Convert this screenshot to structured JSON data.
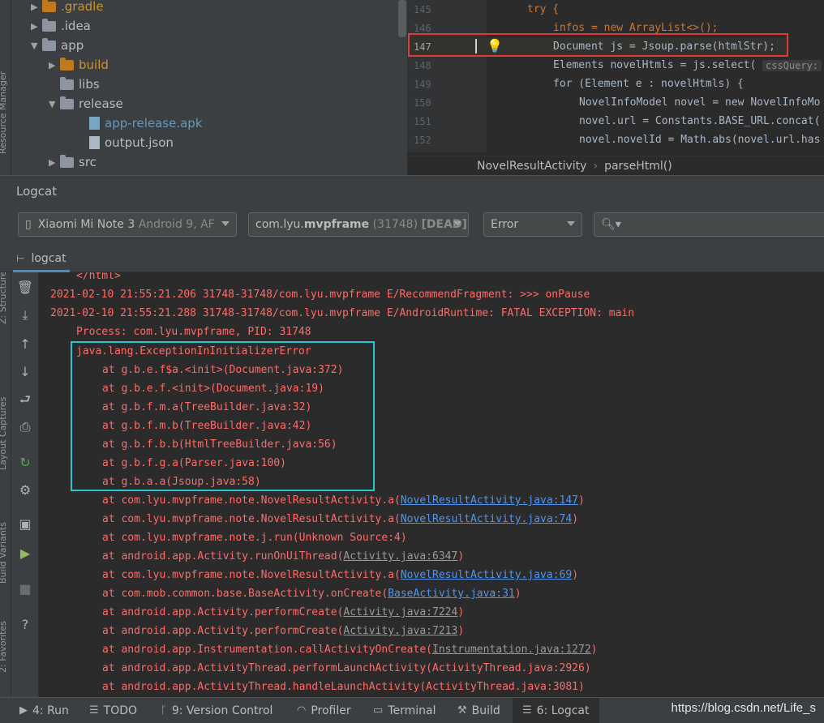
{
  "side_tabs": {
    "resource_manager": "Resource Manager",
    "structure": "Z: Structure",
    "layout_captures": "Layout Captures",
    "build_variants": "Build Variants",
    "favorites": "2: Favorites"
  },
  "project_tree": {
    "items": [
      {
        "label": ".gradle"
      },
      {
        "label": ".idea"
      },
      {
        "label": "app"
      },
      {
        "label": "build"
      },
      {
        "label": "libs"
      },
      {
        "label": "release"
      },
      {
        "label": "app-release.apk"
      },
      {
        "label": "output.json"
      },
      {
        "label": "src"
      }
    ]
  },
  "editor": {
    "lines": [
      {
        "num": "145",
        "text": "try {"
      },
      {
        "num": "146",
        "text": "infos = new ArrayList<>();"
      },
      {
        "num": "147",
        "text": "Document js = Jsoup.parse(htmlStr);"
      },
      {
        "num": "148",
        "text": "Elements novelHtmls = js.select(",
        "hint": "cssQuery:"
      },
      {
        "num": "149",
        "text": "for (Element e : novelHtmls) {"
      },
      {
        "num": "150",
        "text": "NovelInfoModel novel = new NovelInfoMo"
      },
      {
        "num": "151",
        "text": "novel.url = Constants.BASE_URL.concat("
      },
      {
        "num": "152",
        "text": "novel.novelId = Math.abs(novel.url.has"
      }
    ],
    "breadcrumb": {
      "class": "NovelResultActivity",
      "method": "parseHtml()"
    }
  },
  "logcat": {
    "title": "Logcat",
    "device": {
      "name": "Xiaomi Mi Note 3",
      "detail": "Android 9, AF"
    },
    "process": {
      "prefix": "com.lyu.",
      "bold": "mvpframe",
      "pid": "(31748)",
      "state": "[DEAD]"
    },
    "level": "Error",
    "search_placeholder": "",
    "tab": "logcat",
    "lines": [
      "</html>",
      "2021-02-10 21:55:21.206 31748-31748/com.lyu.mvpframe E/RecommendFragment:  >>> onPause",
      "2021-02-10 21:55:21.288 31748-31748/com.lyu.mvpframe E/AndroidRuntime: FATAL EXCEPTION: main",
      "Process: com.lyu.mvpframe, PID: 31748",
      "java.lang.ExceptionInInitializerError",
      "at g.b.e.f$a.<init>(Document.java:372)",
      "at g.b.e.f.<init>(Document.java:19)",
      "at g.b.f.m.a(TreeBuilder.java:32)",
      "at g.b.f.m.b(TreeBuilder.java:42)",
      "at g.b.f.b.b(HtmlTreeBuilder.java:56)",
      "at g.b.f.g.a(Parser.java:100)",
      "at g.b.a.a(Jsoup.java:58)"
    ],
    "link_lines": [
      {
        "pre": "at com.lyu.mvpframe.note.NovelResultActivity.a(",
        "link": "NovelResultActivity.java:147",
        "post": ")"
      },
      {
        "pre": "at com.lyu.mvpframe.note.NovelResultActivity.a(",
        "link": "NovelResultActivity.java:74",
        "post": ")"
      },
      {
        "pre": "at com.lyu.mvpframe.note.j.run(Unknown Source:4)",
        "link": "",
        "post": ""
      },
      {
        "pre": "at android.app.Activity.runOnUiThread(",
        "link": "Activity.java:6347",
        "post": ")"
      },
      {
        "pre": "at com.lyu.mvpframe.note.NovelResultActivity.a(",
        "link": "NovelResultActivity.java:69",
        "post": ")"
      },
      {
        "pre": "at com.mob.common.base.BaseActivity.onCreate(",
        "link": "BaseActivity.java:31",
        "post": ")"
      },
      {
        "pre": "at android.app.Activity.performCreate(",
        "link": "Activity.java:7224",
        "post": ")"
      },
      {
        "pre": "at android.app.Activity.performCreate(",
        "link": "Activity.java:7213",
        "post": ")"
      },
      {
        "pre": "at android.app.Instrumentation.callActivityOnCreate(",
        "link": "Instrumentation.java:1272",
        "post": ")"
      },
      {
        "pre": "at android.app.ActivityThread.performLaunchActivity(ActivityThread.java:2926)",
        "link": "",
        "post": ""
      },
      {
        "pre": "at android.app.ActivityThread.handleLaunchActivity(ActivityThread.java:3081)",
        "link": "",
        "post": ""
      }
    ]
  },
  "bottom_tabs": {
    "run": "4: Run",
    "todo": "TODO",
    "version_control": "9: Version Control",
    "profiler": "Profiler",
    "terminal": "Terminal",
    "build": "Build",
    "logcat": "6: Logcat"
  },
  "watermark": "https://blog.csdn.net/Life_s",
  "colors": {
    "error_text": "#ff6b68",
    "link": "#5394ec",
    "highlight_red": "#e03b3b",
    "highlight_cyan": "#26c6d3"
  }
}
